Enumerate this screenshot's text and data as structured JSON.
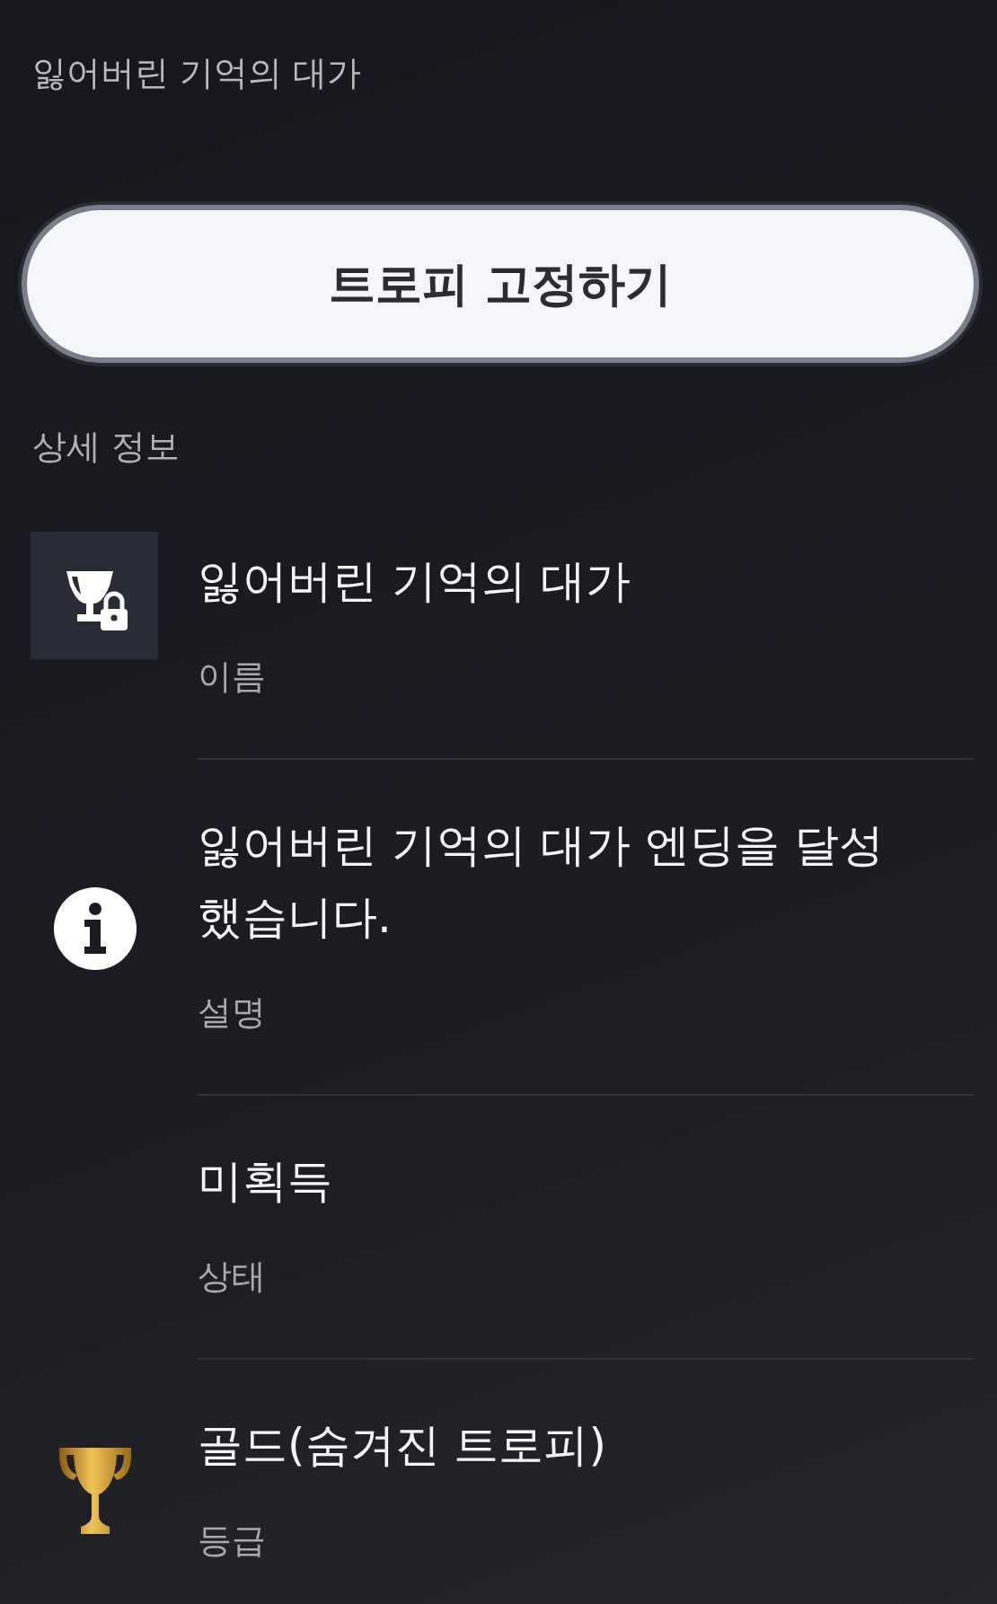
{
  "header": {
    "title": "잃어버린 기억의 대가"
  },
  "pin_button": {
    "label": "트로피 고정하기"
  },
  "section": {
    "title": "상세 정보"
  },
  "details": [
    {
      "kind": "locked-trophy",
      "value": "잃어버린 기억의 대가",
      "label": "이름"
    },
    {
      "kind": "info",
      "value": "잃어버린 기억의 대가 엔딩을 달성했습니다.",
      "label": "설명"
    },
    {
      "kind": "none",
      "value": "미획득",
      "label": "상태"
    },
    {
      "kind": "gold-trophy",
      "value": "골드(숨겨진 트로피)",
      "label": "등급"
    }
  ]
}
